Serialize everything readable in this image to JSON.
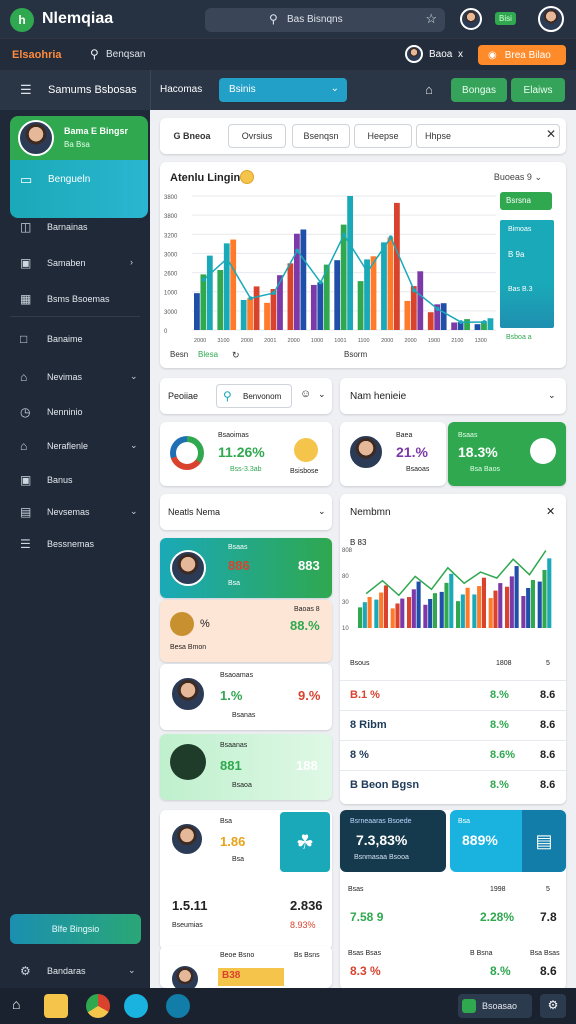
{
  "app": {
    "logo_letter": "h",
    "title": "Nlemqiaa",
    "search_text": "Bas Bisnqns",
    "top_badge": "Bisi",
    "nav_brand": "Elsaohria",
    "nav_search": "Benqsan",
    "nav_user": "Baoa",
    "nav_x": "x",
    "nav_orange": "Brea Bilao"
  },
  "subbar": {
    "title": "Samums Bsbosas",
    "select_label": "Hacomas",
    "select_value": "Bsinis",
    "btn1": "Bongas",
    "btn2": "Elaiws"
  },
  "sidebar": {
    "card_name": "Bama E Bingsr",
    "card_sub": "Ba Bsa",
    "active_label": "Bengueln",
    "items": [
      "Barnainas",
      "Samaben",
      "Bsms Bsoemas",
      "Banaime",
      "Nevimas",
      "Nenninio",
      "Neraflenle",
      "Banus",
      "Nevsemas",
      "Bessnemas"
    ],
    "bottom_button": "Blfe Bingsio",
    "footer": "Bandaras"
  },
  "tabs": [
    "G Bneoa",
    "Ovrsius",
    "Bsenqsn",
    "Heepse",
    "Hhpse"
  ],
  "chart1": {
    "title": "Atenlu Lingin",
    "right_label": "Buoeas 9",
    "green_btn": "Bsrsna",
    "panel_lines": [
      "Bimoas",
      "B 9a",
      "Bas B.3"
    ],
    "panel_foot": "Bsboa a",
    "y_ticks": [
      "3800",
      "3800",
      "3200",
      "3000",
      "2600",
      "1000",
      "3000",
      "0"
    ],
    "x_ticks": [
      "2000",
      "3100",
      "2000",
      "2001",
      "2000",
      "1000",
      "1001",
      "1100",
      "2000",
      "2000",
      "1900",
      "2100",
      "1300"
    ],
    "legend_left": "Besn",
    "legend_green": "Blesa",
    "legend_right": "Bsorm"
  },
  "chart_data": {
    "type": "bar",
    "title": "Atenlu Lingin",
    "categories": [
      "2000",
      "3100",
      "2000",
      "2001",
      "2000",
      "1000",
      "1001",
      "1100",
      "2000",
      "2000",
      "1900",
      "2100",
      "1300"
    ],
    "series": [
      {
        "values": [
          1900,
          2700,
          1200,
          1400,
          3000,
          1800,
          3600,
          2200,
          3500,
          1500,
          800,
          300,
          300
        ]
      }
    ],
    "ylim": [
      0,
      3800
    ]
  },
  "row3": {
    "left_label": "Peoiiae",
    "left_search": "Benvonom",
    "right_label": "Nam henieie"
  },
  "kpis": [
    {
      "top": "Bsaoimas",
      "value": "11.26%",
      "foot": "Bss-3.3ab",
      "side": "Bsisbose"
    },
    {
      "top": "Baea",
      "value": "21.%",
      "foot": "Bsaoas"
    },
    {
      "top": "Bsaas",
      "value": "18.3%",
      "foot": "Bsa Baos"
    }
  ],
  "left_list": {
    "header": "Neatls Nema",
    "items": [
      {
        "top": "Bsaas",
        "v1": "886",
        "v2": "883",
        "foot": "Bsa"
      },
      {
        "top": "Baoas 8",
        "v1": "%",
        "v2": "88.%",
        "foot": "Besa Bmon"
      },
      {
        "top": "Bsaoamas",
        "v1": "1.%",
        "v2": "9.%",
        "foot": "Bsanas"
      },
      {
        "top": "Bsaanas",
        "v1": "881",
        "v2": "188",
        "foot": "Bsaoa"
      }
    ]
  },
  "right_panel": {
    "title": "Nembmn",
    "chart_label": "B 83",
    "y_ticks": [
      "808",
      "80",
      "30",
      "10"
    ],
    "table_header": [
      "Bsous",
      "1808",
      "5"
    ],
    "rows": [
      {
        "left": "B.1 %",
        "mid": "8.%",
        "right": "8.6"
      },
      {
        "left": "8 Ribm",
        "mid": "8.%",
        "right": "8.6"
      },
      {
        "left": "8 %",
        "mid": "8.6%",
        "right": "8.6"
      },
      {
        "left": "B Beon Bgsn",
        "mid": "8.%",
        "right": "8.6"
      }
    ]
  },
  "chart2_data": {
    "type": "bar",
    "series": [
      {
        "values": [
          40,
          55,
          38,
          60,
          45,
          70,
          52,
          65,
          58,
          80,
          62,
          90
        ]
      }
    ]
  },
  "bottom_left": {
    "top": "Bsa",
    "v1": "1.86",
    "foot": "Bsa",
    "big1": "1.5.11",
    "big2": "2.836",
    "foot2": "Bseumias",
    "foot3": "8.93%",
    "last_top": "Beoe Bsno",
    "last_right": "Bs Bsns",
    "last_v": "B38"
  },
  "bottom_right": {
    "top": "Bsrneaaras Bsoede",
    "value": "7.3,83%",
    "foot": "Bsnmasaa Bsooa",
    "card2_top": "Bsa",
    "card2_value": "889%",
    "row1": [
      "Bsas",
      "1998",
      "5"
    ],
    "row2": [
      "7.58 9",
      "2.28%",
      "7.8"
    ],
    "row3": [
      "Bsas Bsas",
      "B Bsna",
      "Bsa Bsas"
    ],
    "row4": [
      "8.3 %",
      "8.%",
      "8.6"
    ]
  },
  "taskbar": {
    "right_label": "Bsoasao"
  }
}
